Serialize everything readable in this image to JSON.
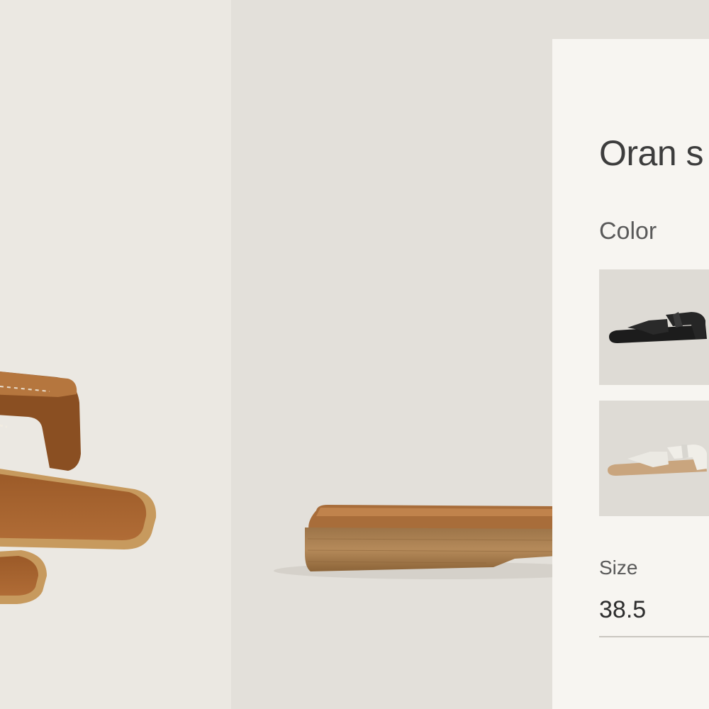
{
  "product": {
    "title": "Oran s",
    "color_label": "Color",
    "swatches": [
      {
        "name": "black",
        "color": "#1f1f1f"
      },
      {
        "name": "white",
        "color": "#e4e2dc"
      }
    ],
    "size_label": "Size",
    "size_value": "38.5"
  },
  "colors": {
    "leather": "#a0602c",
    "sole": "#b8885a",
    "panel_bg": "#f7f5f1",
    "photo_bg": "#e6e3dc"
  }
}
